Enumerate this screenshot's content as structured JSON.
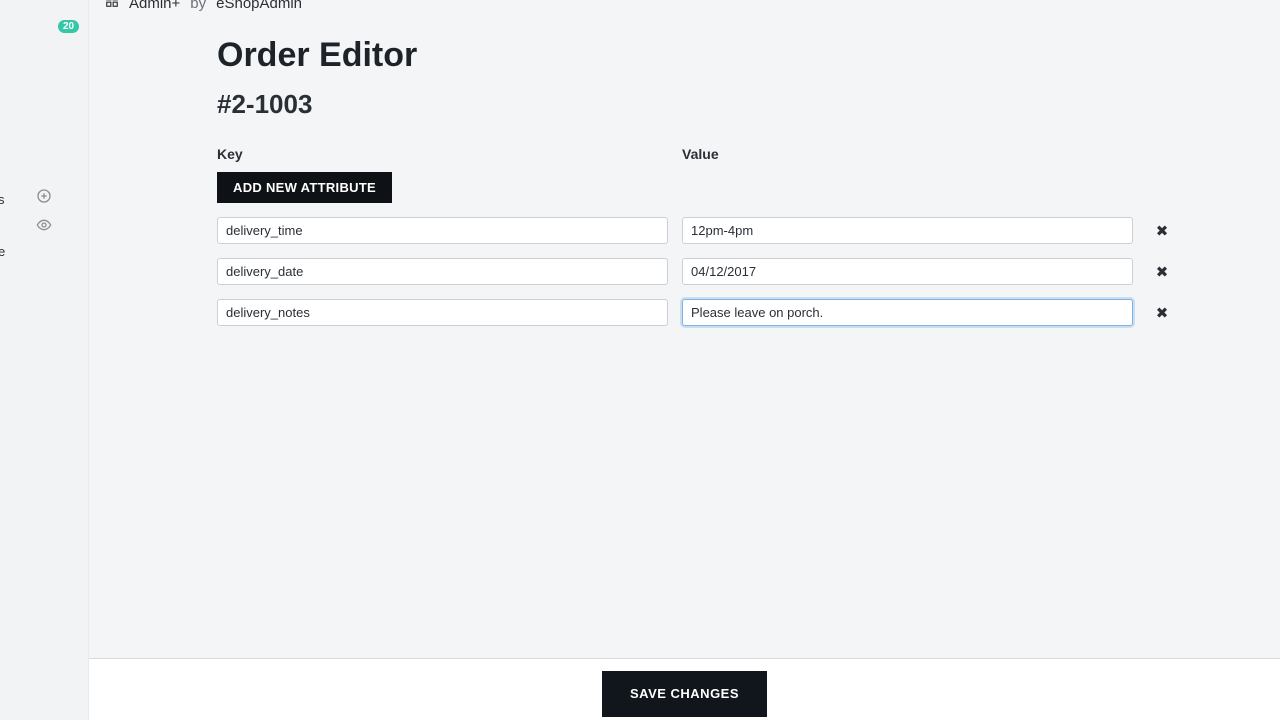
{
  "brand": {
    "name": "Admin+",
    "by_word": "by",
    "by": "eShopAdmin"
  },
  "sidebar": {
    "badge": "20",
    "frag1": "s",
    "frag2": "e"
  },
  "page": {
    "title": "Order Editor",
    "order_id": "#2-1003"
  },
  "columns": {
    "key": "Key",
    "value": "Value"
  },
  "buttons": {
    "add": "ADD NEW ATTRIBUTE",
    "save": "SAVE CHANGES"
  },
  "attributes": [
    {
      "key": "delivery_time",
      "value": "12pm-4pm",
      "focused": false
    },
    {
      "key": "delivery_date",
      "value": "04/12/2017",
      "focused": false
    },
    {
      "key": "delivery_notes",
      "value": "Please leave on porch.",
      "focused": true
    }
  ]
}
